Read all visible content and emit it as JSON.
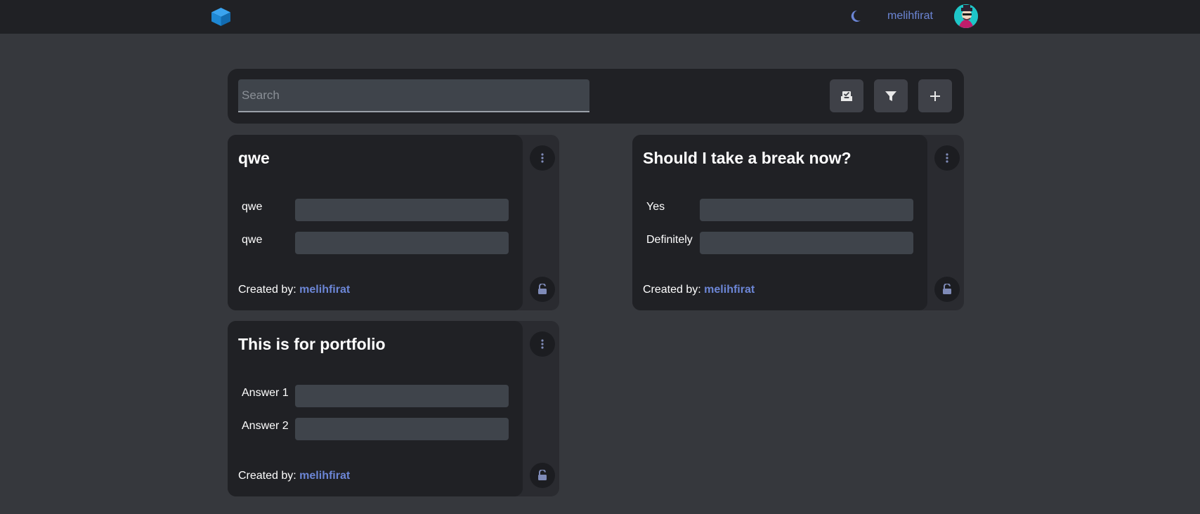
{
  "header": {
    "logo_icon": "cube-icon",
    "theme_icon": "moon-icon",
    "username": "melihfirat",
    "avatar_icon": "avatar"
  },
  "toolbar": {
    "search_placeholder": "Search",
    "buttons": [
      {
        "icon": "inbox-check-icon"
      },
      {
        "icon": "filter-icon"
      },
      {
        "icon": "plus-icon"
      }
    ]
  },
  "polls": [
    {
      "title": "qwe",
      "options": [
        "qwe",
        "qwe"
      ],
      "created_label": "Created by:",
      "author": "melihfirat"
    },
    {
      "title": "Should I take a break now?",
      "options": [
        "Yes",
        "Definitely"
      ],
      "created_label": "Created by:",
      "author": "melihfirat"
    },
    {
      "title": "This is for portfolio",
      "options": [
        "Answer 1",
        "Answer 2"
      ],
      "created_label": "Created by:",
      "author": "melihfirat"
    }
  ],
  "colors": {
    "accent": "#6c86d6",
    "logo": "#1e88d4",
    "background": "#36383d",
    "panel": "#202125"
  }
}
